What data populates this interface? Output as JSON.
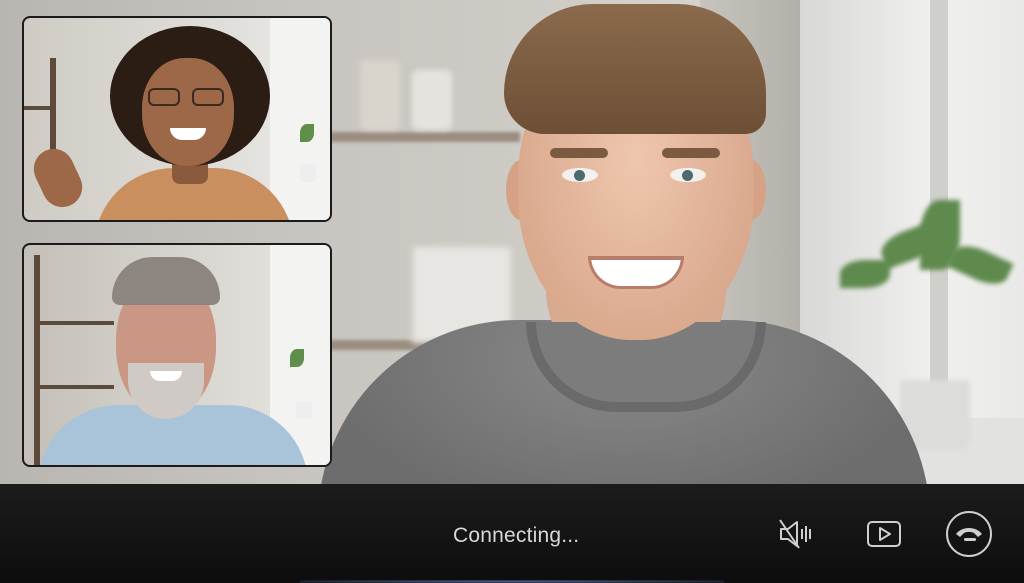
{
  "call": {
    "status_text": "Connecting..."
  },
  "participants": [
    {
      "role": "main-speaker",
      "tile": "main-video"
    },
    {
      "role": "participant",
      "tile": "thumbnail-1"
    },
    {
      "role": "participant",
      "tile": "thumbnail-2"
    }
  ],
  "controls": [
    {
      "name": "mute",
      "icon": "speaker-muted-icon"
    },
    {
      "name": "video",
      "icon": "video-play-icon"
    },
    {
      "name": "end-call",
      "icon": "phone-hangup-icon"
    }
  ],
  "colors": {
    "control_bar_bg": "#111111",
    "control_icon": "#cfcfcf",
    "status_text": "#d8d8d8"
  }
}
